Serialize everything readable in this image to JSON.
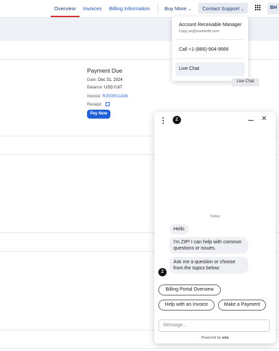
{
  "nav": {
    "overview": "Overview",
    "invoices": "Invoices",
    "billing": "Billing Information",
    "buy_more": "Buy More",
    "contact": "Contact Support",
    "avatar": "BH"
  },
  "payment": {
    "title": "Payment Due",
    "date_label": "Date:",
    "date_value": "Dec 31, 2024",
    "balance_label": "Balance:",
    "balance_value": "USD 0.87",
    "invoice_label": "Invoice:",
    "invoice_value": "R2000011436",
    "receipt_label": "Receipt:",
    "pay_button": "Pay Now"
  },
  "dropdown": {
    "manager_title": "Account Receivable Manager",
    "manager_sub": "Copy ar@zoominfo.com",
    "call": "Call +1-(866)-904-9666",
    "live_chat": "Live Chat"
  },
  "tooltip": "Live Chat",
  "chat": {
    "logo": "Z",
    "today": "Today",
    "messages": [
      "Hello",
      "I'm ZIP! I can help with common questions or issues.",
      "Ask me a question or choose from the topics below:"
    ],
    "chips": [
      "Billing Portal Overview",
      "Help with an Invoice",
      "Make a Payment"
    ],
    "input_placeholder": "Message...",
    "powered_by": "Powered by",
    "powered_brand": "ada"
  },
  "icons": {
    "grid": "apps-grid-icon",
    "chevron": "chevron-down-icon",
    "external": "external-link-icon",
    "kebab": "more-vert-icon",
    "minimize": "minimize-icon",
    "close": "close-icon"
  },
  "colors": {
    "primary": "#1f5fd8",
    "active_underline": "#d43131",
    "nav_text": "#1f3a7a"
  }
}
